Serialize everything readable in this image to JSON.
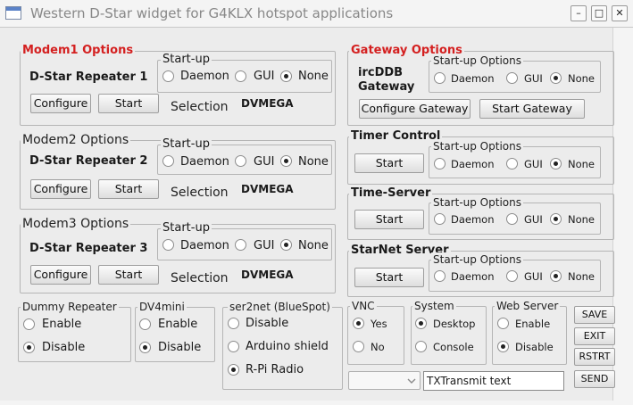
{
  "window": {
    "title": "Western D-Star widget for G4KLX hotspot applications"
  },
  "modems": [
    {
      "title": "Modem1 Options",
      "name": "D-Star Repeater 1",
      "startup_label": "Start-up",
      "options": [
        "Daemon",
        "GUI",
        "None"
      ],
      "selected": "None",
      "configure": "Configure",
      "start": "Start",
      "selection_label": "Selection",
      "selection_value": "DVMEGA"
    },
    {
      "title": "Modem2 Options",
      "name": "D-Star Repeater 2",
      "startup_label": "Start-up",
      "options": [
        "Daemon",
        "GUI",
        "None"
      ],
      "selected": "None",
      "configure": "Configure",
      "start": "Start",
      "selection_label": "Selection",
      "selection_value": "DVMEGA"
    },
    {
      "title": "Modem3 Options",
      "name": "D-Star Repeater 3",
      "startup_label": "Start-up",
      "options": [
        "Daemon",
        "GUI",
        "None"
      ],
      "selected": "None",
      "configure": "Configure",
      "start": "Start",
      "selection_label": "Selection",
      "selection_value": "DVMEGA"
    }
  ],
  "gateway": {
    "title": "Gateway Options",
    "name_line1": "ircDDB",
    "name_line2": "Gateway",
    "startup_label": "Start-up Options",
    "options": [
      "Daemon",
      "GUI",
      "None"
    ],
    "selected": "None",
    "configure": "Configure Gateway",
    "start": "Start Gateway"
  },
  "timer": {
    "title": "Timer Control",
    "start": "Start",
    "startup_label": "Start-up Options",
    "options": [
      "Daemon",
      "GUI",
      "None"
    ],
    "selected": "None"
  },
  "timeserver": {
    "title": "Time-Server",
    "start": "Start",
    "startup_label": "Start-up Options",
    "options": [
      "Daemon",
      "GUI",
      "None"
    ],
    "selected": "None"
  },
  "starnet": {
    "title": "StarNet Server",
    "start": "Start",
    "startup_label": "Start-up Options",
    "options": [
      "Daemon",
      "GUI",
      "None"
    ],
    "selected": "None"
  },
  "dummy": {
    "title": "Dummy Repeater",
    "options": [
      "Enable",
      "Disable"
    ],
    "selected": "Disable"
  },
  "dv4mini": {
    "title": "DV4mini",
    "options": [
      "Enable",
      "Disable"
    ],
    "selected": "Disable"
  },
  "ser2net": {
    "title": "ser2net  (BlueSpot)",
    "options": [
      "Disable",
      "Arduino shield",
      "R-Pi Radio"
    ],
    "selected": "R-Pi Radio"
  },
  "vnc": {
    "title": "VNC",
    "options": [
      "Yes",
      "No"
    ],
    "selected": "Yes"
  },
  "system": {
    "title": "System",
    "options": [
      "Desktop",
      "Console"
    ],
    "selected": "Desktop"
  },
  "webserver": {
    "title": "Web Server",
    "options": [
      "Enable",
      "Disable"
    ],
    "selected": "Disable"
  },
  "side_buttons": {
    "save": "SAVE",
    "exit": "EXIT",
    "restart": "RSTRT",
    "send": "SEND"
  },
  "transmit": {
    "combo_value": "",
    "text": "TXTransmit text"
  }
}
